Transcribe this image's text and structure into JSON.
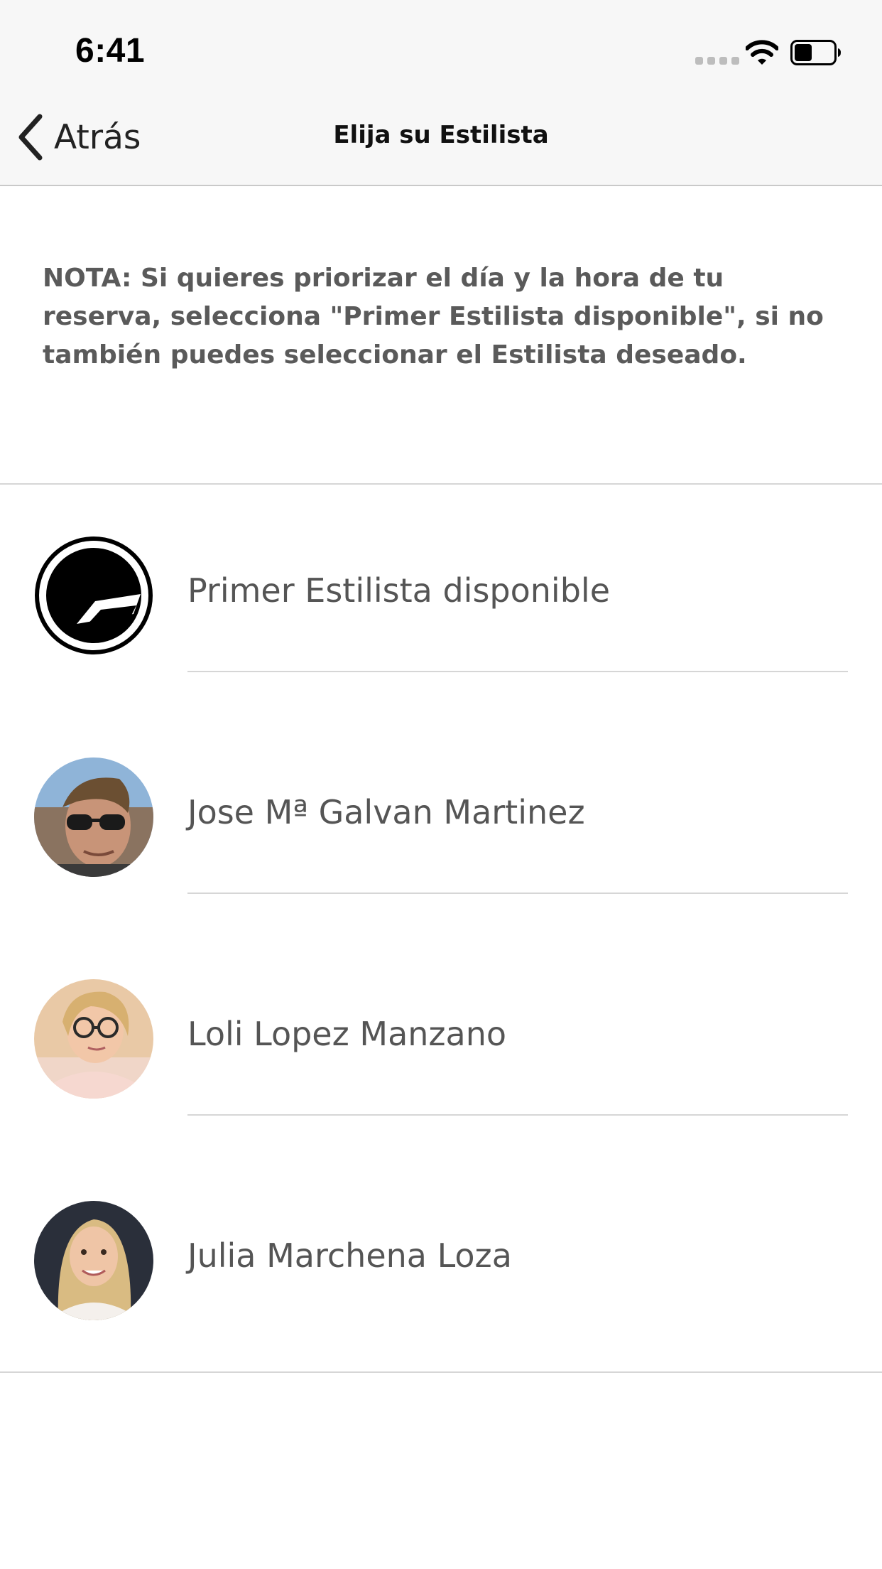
{
  "status_bar": {
    "time": "6:41",
    "battery_level": 0.45
  },
  "nav": {
    "back_label": "Atrás",
    "title": "Elija su Estilista"
  },
  "note": {
    "text": "NOTA: Si quieres priorizar el día y la hora de tu reserva, selecciona \"Primer Estilista disponible\", si no también puedes seleccionar el Estilista deseado."
  },
  "stylists": [
    {
      "name": "Primer Estilista disponible",
      "avatar": "brand-logo-icon"
    },
    {
      "name": "Jose Mª Galvan Martinez",
      "avatar": "photo-man-sunglasses"
    },
    {
      "name": "Loli Lopez Manzano",
      "avatar": "photo-woman-glasses"
    },
    {
      "name": "Julia Marchena Loza",
      "avatar": "photo-woman-blonde"
    }
  ],
  "colors": {
    "bar_background": "#f7f7f7",
    "text_gray": "#555555",
    "divider": "#d6d6d6"
  }
}
